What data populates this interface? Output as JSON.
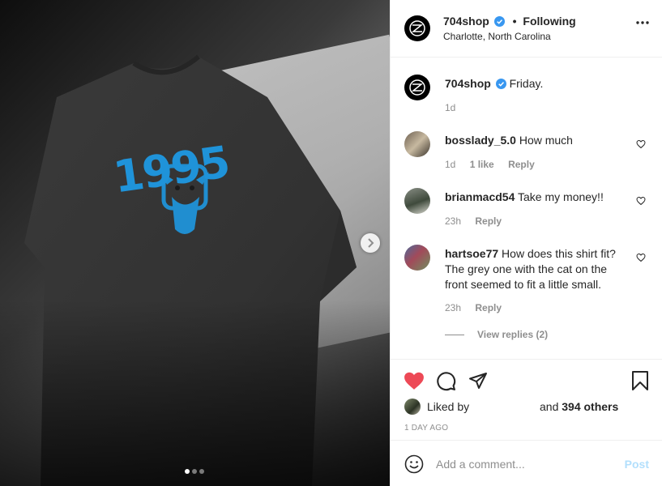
{
  "post": {
    "username": "704shop",
    "follow_status": "Following",
    "dot": "•",
    "location": "Charlotte, North Carolina",
    "shirt_print": "1995",
    "carousel": {
      "total": 3,
      "active_index": 0
    },
    "colors": {
      "accent_blue": "#1f93d9",
      "like_red": "#ed4956",
      "verified_blue": "#3897f0",
      "post_disabled": "#b2dffc"
    }
  },
  "caption": {
    "username": "704shop",
    "text": "Friday.",
    "time": "1d"
  },
  "comments": [
    {
      "username": "bosslady_5.0",
      "text": "How much",
      "time": "1d",
      "likes": "1 like",
      "reply": "Reply"
    },
    {
      "username": "brianmacd54",
      "text": "Take my money!!",
      "time": "23h",
      "reply": "Reply"
    },
    {
      "username": "hartsoe77",
      "text": "How does this shirt fit? The grey one with the cat on the front seemed to fit a little small.",
      "time": "23h",
      "reply": "Reply"
    }
  ],
  "view_replies": "View replies (2)",
  "likes": {
    "liked_by": "Liked by",
    "and_text": "and",
    "others": "394 others"
  },
  "timestamp": "1 DAY AGO",
  "comment_box": {
    "placeholder": "Add a comment...",
    "post_label": "Post"
  },
  "icons": {
    "more": "more-options-icon",
    "verified": "verified-badge-icon",
    "heart": "heart-icon",
    "comment": "comment-icon",
    "share": "share-icon",
    "bookmark": "bookmark-icon",
    "emoji": "emoji-icon",
    "next": "chevron-right-icon"
  }
}
